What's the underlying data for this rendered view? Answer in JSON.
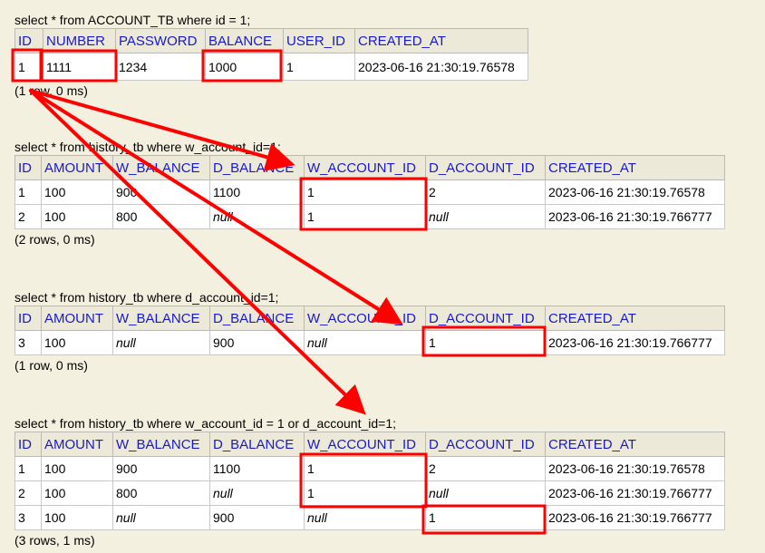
{
  "results": [
    {
      "query": "select * from ACCOUNT_TB where id = 1;",
      "columns": [
        "ID",
        "NUMBER",
        "PASSWORD",
        "BALANCE",
        "USER_ID",
        "CREATED_AT"
      ],
      "rows": [
        [
          "1",
          "1111",
          "1234",
          "1000",
          "1",
          "2023-06-16 21:30:19.76578"
        ]
      ],
      "rowinfo": "(1 row, 0 ms)"
    },
    {
      "query": "select * from history_tb where w_account_id=1;",
      "columns": [
        "ID",
        "AMOUNT",
        "W_BALANCE",
        "D_BALANCE",
        "W_ACCOUNT_ID",
        "D_ACCOUNT_ID",
        "CREATED_AT"
      ],
      "rows": [
        [
          "1",
          "100",
          "900",
          "1100",
          "1",
          "2",
          "2023-06-16 21:30:19.76578"
        ],
        [
          "2",
          "100",
          "800",
          "null",
          "1",
          "null",
          "2023-06-16 21:30:19.766777"
        ]
      ],
      "rowinfo": "(2 rows, 0 ms)"
    },
    {
      "query": "select * from history_tb where d_account_id=1;",
      "columns": [
        "ID",
        "AMOUNT",
        "W_BALANCE",
        "D_BALANCE",
        "W_ACCOUNT_ID",
        "D_ACCOUNT_ID",
        "CREATED_AT"
      ],
      "rows": [
        [
          "3",
          "100",
          "null",
          "900",
          "null",
          "1",
          "2023-06-16 21:30:19.766777"
        ]
      ],
      "rowinfo": "(1 row, 0 ms)"
    },
    {
      "query": "select * from history_tb where w_account_id = 1 or d_account_id=1;",
      "columns": [
        "ID",
        "AMOUNT",
        "W_BALANCE",
        "D_BALANCE",
        "W_ACCOUNT_ID",
        "D_ACCOUNT_ID",
        "CREATED_AT"
      ],
      "rows": [
        [
          "1",
          "100",
          "900",
          "1100",
          "1",
          "2",
          "2023-06-16 21:30:19.76578"
        ],
        [
          "2",
          "100",
          "800",
          "null",
          "1",
          "null",
          "2023-06-16 21:30:19.766777"
        ],
        [
          "3",
          "100",
          "null",
          "900",
          "null",
          "1",
          "2023-06-16 21:30:19.766777"
        ]
      ],
      "rowinfo": "(3 rows, 1 ms)"
    }
  ],
  "annotation_color": "#ff0000",
  "null_text": "null"
}
